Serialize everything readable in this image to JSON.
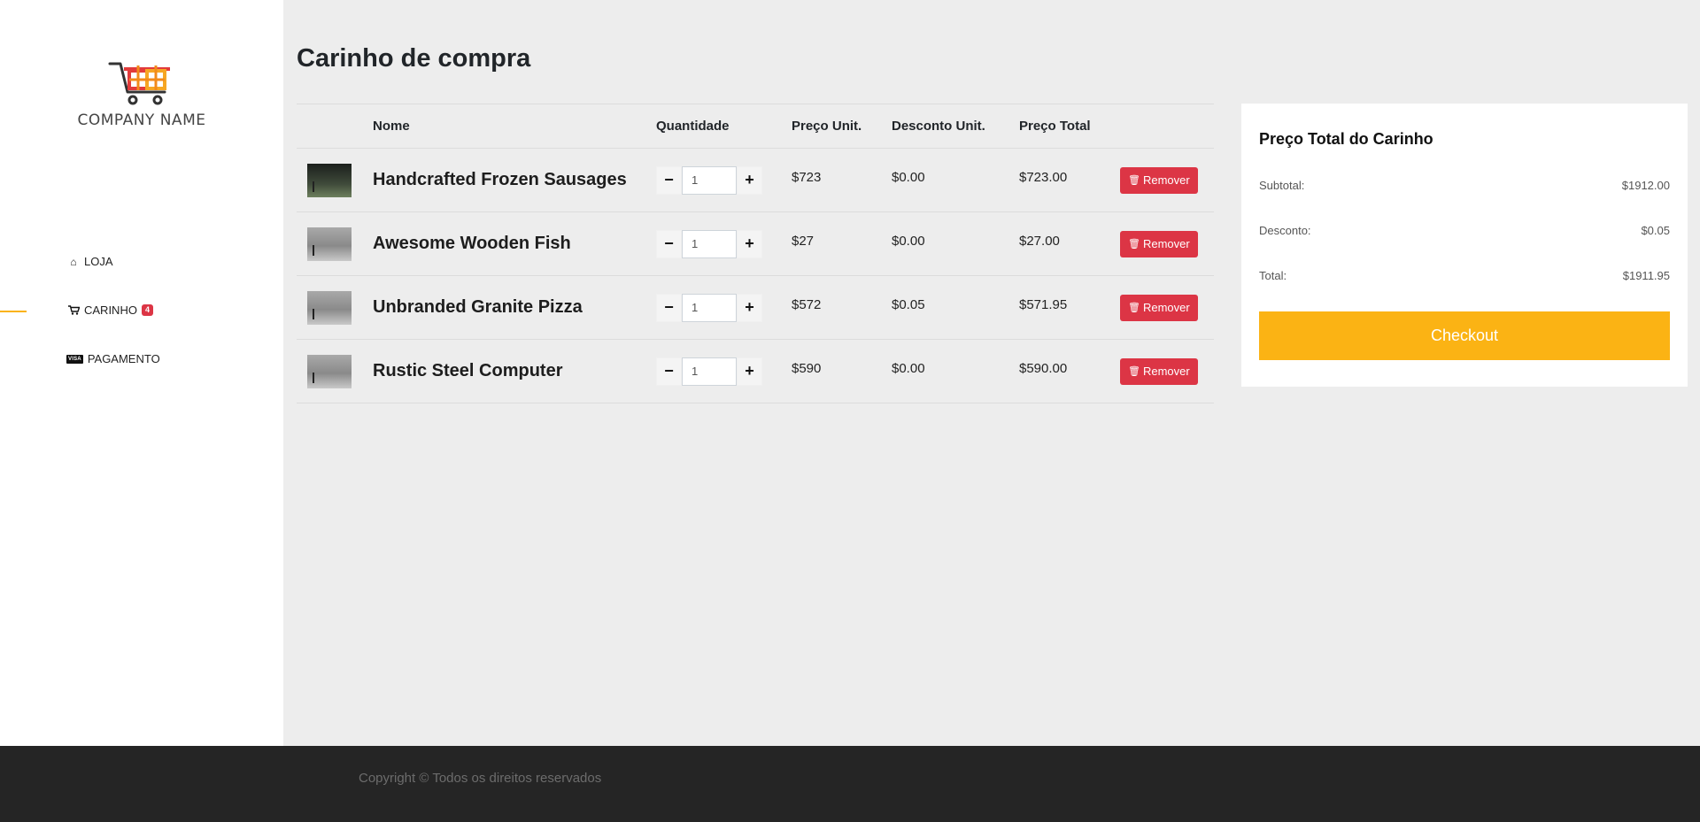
{
  "sidebar": {
    "logo_text": "COMPANY NAME",
    "nav": [
      {
        "label": "LOJA",
        "icon": "home-icon"
      },
      {
        "label": "CARINHO",
        "icon": "cart-icon",
        "badge": "4",
        "active": true
      },
      {
        "label": "PAGAMENTO",
        "icon": "visa-icon",
        "icon_text": "VISA"
      }
    ]
  },
  "main": {
    "title": "Carinho de compra",
    "table": {
      "headers": [
        "",
        "Nome",
        "Quantidade",
        "Preço Unit.",
        "Desconto Unit.",
        "Preço Total",
        ""
      ],
      "rows": [
        {
          "name": "Handcrafted Frozen Sausages",
          "qty": "1",
          "unit": "$723",
          "discount": "$0.00",
          "total": "$723.00",
          "remove": "Remover"
        },
        {
          "name": "Awesome Wooden Fish",
          "qty": "1",
          "unit": "$27",
          "discount": "$0.00",
          "total": "$27.00",
          "remove": "Remover"
        },
        {
          "name": "Unbranded Granite Pizza",
          "qty": "1",
          "unit": "$572",
          "discount": "$0.05",
          "total": "$571.95",
          "remove": "Remover"
        },
        {
          "name": "Rustic Steel Computer",
          "qty": "1",
          "unit": "$590",
          "discount": "$0.00",
          "total": "$590.00",
          "remove": "Remover"
        }
      ]
    }
  },
  "summary": {
    "title": "Preço Total do Carinho",
    "subtotal_label": "Subtotal:",
    "subtotal_value": "$1912.00",
    "discount_label": "Desconto:",
    "discount_value": "$0.05",
    "total_label": "Total:",
    "total_value": "$1911.95",
    "checkout_label": "Checkout"
  },
  "footer": {
    "text": "Copyright © Todos os direitos reservados"
  },
  "colors": {
    "accent": "#fbb314",
    "danger": "#dc3545",
    "footer_bg": "#252525"
  }
}
